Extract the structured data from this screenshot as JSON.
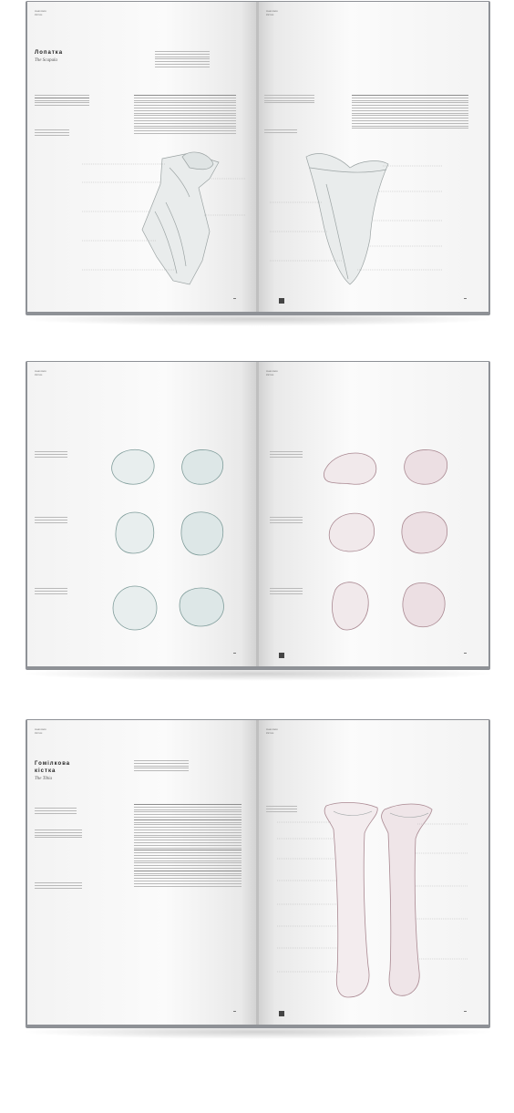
{
  "spreads": [
    {
      "left": {
        "header": [
          "Анатомія",
          "Кістки"
        ],
        "title": "Лопатка",
        "latin": "The Scapula"
      },
      "right": {
        "header": [
          "Анатомія",
          "Кістки"
        ]
      }
    },
    {
      "left": {
        "header": [
          "Анатомія",
          "Кістки"
        ]
      },
      "right": {
        "header": [
          "Анатомія",
          "Кістки"
        ]
      }
    },
    {
      "left": {
        "header": [
          "Анатомія",
          "Кістки"
        ],
        "title_line1": "Гомілкова",
        "title_line2": "кістка",
        "latin": "The Tibia"
      },
      "right": {
        "header": [
          "Анатомія",
          "Кістки"
        ]
      }
    }
  ],
  "colors": {
    "cover": "#8e9196",
    "bone_grey": "#9ba3a3",
    "bone_teal": "#7f9c9a",
    "bone_mauve": "#a98891"
  }
}
